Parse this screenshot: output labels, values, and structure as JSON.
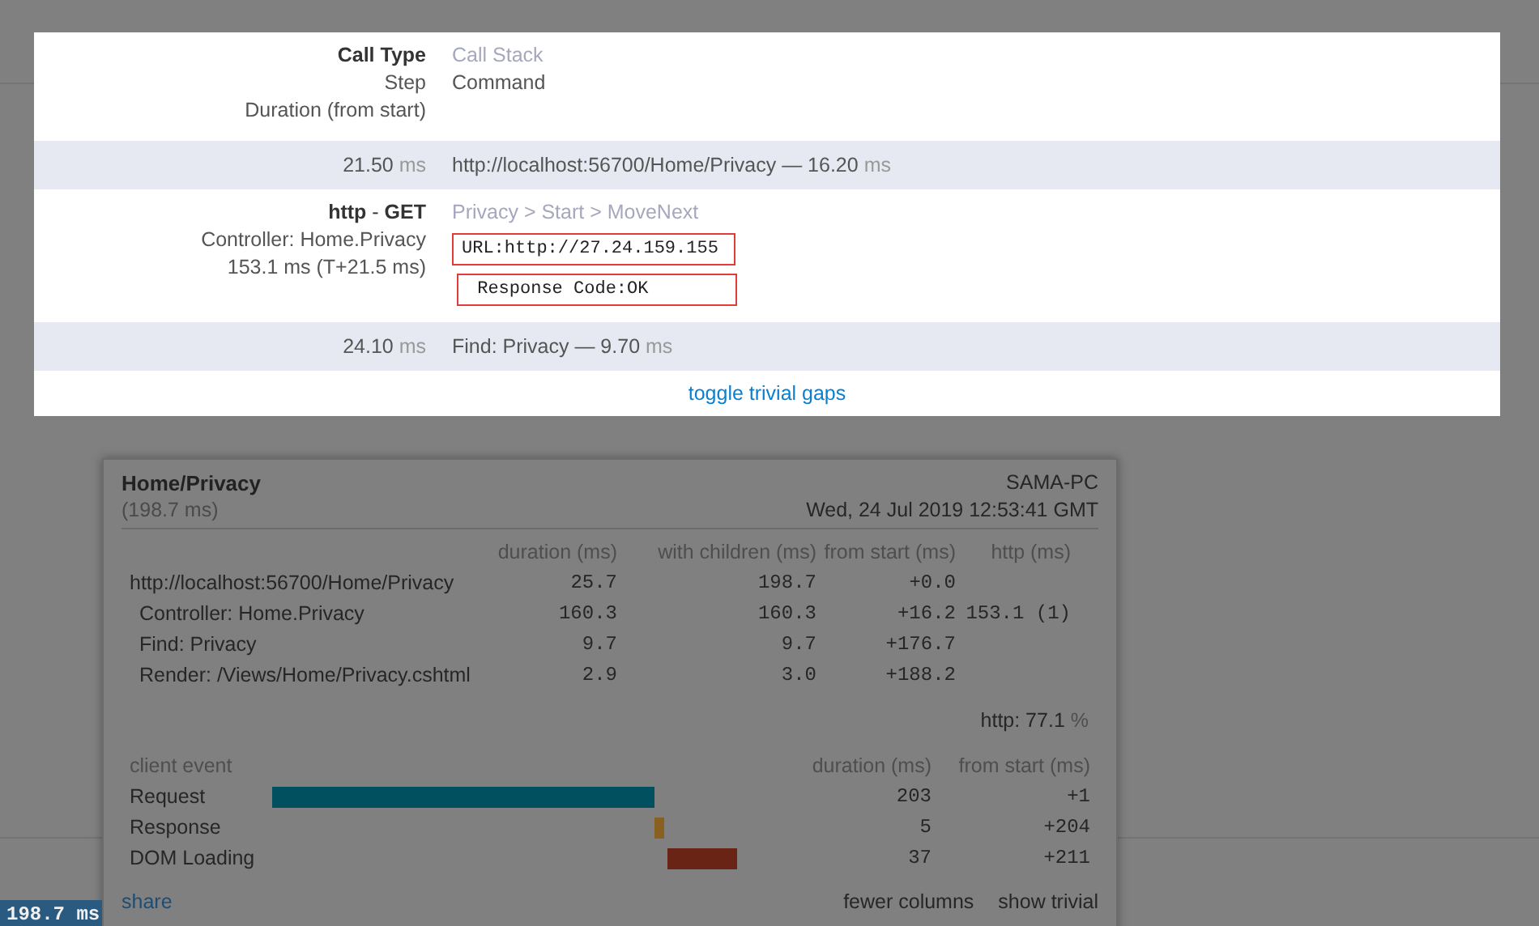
{
  "detail": {
    "header": {
      "labels": [
        "Call Type",
        "Step",
        "Duration (from start)"
      ],
      "stack": "Call Stack",
      "command": "Command"
    },
    "rows": [
      {
        "kind": "gap",
        "duration": "21.50",
        "unit": "ms",
        "text": "http://localhost:56700/Home/Privacy — 16.20",
        "text_unit": "ms"
      },
      {
        "kind": "call",
        "type": "**http** - **GET**",
        "step": "Controller: Home.Privacy",
        "timing": "153.1 ms (T+21.5 ms)",
        "stack": "Privacy > Start > MoveNext",
        "command": [
          "URL:http://27.24.159.155",
          " Response Code:OK"
        ]
      },
      {
        "kind": "gap",
        "duration": "24.10",
        "unit": "ms",
        "text": "Find: Privacy — 9.70",
        "text_unit": "ms"
      }
    ],
    "toggle": "toggle trivial gaps"
  },
  "popup": {
    "title": "Home/Privacy",
    "machine": "SAMA-PC",
    "duration": "(198.7 ms)",
    "date": "Wed, 24 Jul 2019 12:53:41 GMT",
    "columns": [
      "duration (ms)",
      "with children (ms)",
      "from start (ms)",
      "http (ms)"
    ],
    "timings": [
      {
        "name": "http://localhost:56700/Home/Privacy",
        "cells": [
          "25.7",
          "198.7",
          "+0.0",
          ""
        ],
        "children": [
          {
            "name": "Controller: Home.Privacy",
            "cells": [
              "160.3",
              "160.3",
              "+16.2",
              "153.1 (1)"
            ]
          },
          {
            "name": "Find: Privacy",
            "cells": [
              "9.7",
              "9.7",
              "+176.7",
              ""
            ]
          },
          {
            "name": "Render: /Views/Home/Privacy.cshtml",
            "cells": [
              "2.9",
              "3.0",
              "+188.2",
              ""
            ]
          }
        ]
      }
    ],
    "http_label": "http:",
    "http_value": "77.1",
    "http_unit": "%",
    "client_columns": [
      "client event",
      "duration (ms)",
      "from start (ms)"
    ],
    "client_events": [
      {
        "name": "Request",
        "duration": "203",
        "start": "+1",
        "color": "#005060"
      },
      {
        "name": "Response",
        "duration": "5",
        "start": "+204",
        "color": "#8a6020"
      },
      {
        "name": "DOM Loading",
        "duration": "37",
        "start": "+211",
        "color": "#6a2416"
      }
    ],
    "links": {
      "share": "share",
      "fewer": "fewer columns",
      "trivial": "show trivial"
    }
  },
  "badge": "198.7 ms"
}
